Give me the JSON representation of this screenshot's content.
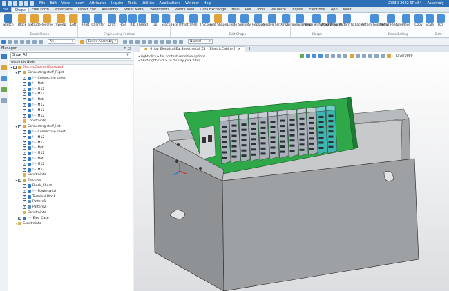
{
  "titlebar": {
    "menu": [
      "File",
      "Edit",
      "View",
      "Insert",
      "Attributes",
      "Inquire",
      "Tools",
      "Utilities",
      "Applications",
      "Window",
      "Help"
    ],
    "product": "ZW3D 2022 SP x64",
    "doc": "Assembly -"
  },
  "ribbon_tabs": [
    {
      "label": "File",
      "style": "file"
    },
    {
      "label": "Shape",
      "style": "active"
    },
    {
      "label": "Free Form"
    },
    {
      "label": "Wireframe"
    },
    {
      "label": "Direct Edit"
    },
    {
      "label": "Assembly"
    },
    {
      "label": "Sheet Metal"
    },
    {
      "label": "Weldments"
    },
    {
      "label": "Point Cloud"
    },
    {
      "label": "Data Exchange"
    },
    {
      "label": "Heal"
    },
    {
      "label": "PMI"
    },
    {
      "label": "Tools"
    },
    {
      "label": "Visualize"
    },
    {
      "label": "Inquire"
    },
    {
      "label": "Electrode"
    },
    {
      "label": "App"
    },
    {
      "label": "Mold"
    }
  ],
  "ribbon_buttons": [
    {
      "label": "Sketch",
      "icon": "sketch-icon",
      "color": "#3b7dc4"
    },
    {
      "label": "Block",
      "icon": "block-icon",
      "color": "#e0a23a"
    },
    {
      "label": "Extrude",
      "icon": "extrude-icon",
      "color": "#e0a23a"
    },
    {
      "label": "Revolve",
      "icon": "revolve-icon",
      "color": "#e0a23a"
    },
    {
      "label": "Sweep",
      "icon": "sweep-icon",
      "color": "#e0a23a"
    },
    {
      "label": "Loft",
      "icon": "loft-icon",
      "color": "#e0a23a"
    },
    {
      "label": "Fillet",
      "icon": "fillet-icon",
      "color": "#4a90d9"
    },
    {
      "label": "Chamfer",
      "icon": "chamfer-icon",
      "color": "#4a90d9"
    },
    {
      "label": "Draft",
      "icon": "draft-icon",
      "color": "#4a90d9"
    },
    {
      "label": "Hole",
      "icon": "hole-icon",
      "color": "#4a90d9"
    },
    {
      "label": "Rib",
      "icon": "rib-icon",
      "color": "#4a90d9"
    },
    {
      "label": "Thread",
      "icon": "thread-icon",
      "color": "#4a90d9"
    },
    {
      "label": "Lip",
      "icon": "lip-icon",
      "color": "#4a90d9"
    },
    {
      "label": "Stock",
      "icon": "stock-icon",
      "color": "#4a90d9"
    },
    {
      "label": "Face Offset",
      "icon": "face-offset-icon",
      "color": "#4a90d9"
    },
    {
      "label": "Shell",
      "icon": "shell-icon",
      "color": "#4a90d9"
    },
    {
      "label": "Thicken",
      "icon": "thicken-icon",
      "color": "#4a90d9"
    },
    {
      "label": "Add Shape",
      "icon": "add-shape-icon",
      "color": "#e0a23a"
    },
    {
      "label": "Divide",
      "icon": "divide-icon",
      "color": "#4a90d9"
    },
    {
      "label": "Simplify",
      "icon": "simplify-icon",
      "color": "#4a90d9"
    },
    {
      "label": "Replace",
      "icon": "replace-icon",
      "color": "#4a90d9"
    },
    {
      "label": "Resolve SelfX",
      "icon": "resolve-icon",
      "color": "#4a90d9"
    },
    {
      "label": "Inlay",
      "icon": "inlay-icon",
      "color": "#4a90d9"
    },
    {
      "label": "Cylindrical Bend",
      "icon": "cyl-bend-icon",
      "color": "#4a90d9"
    },
    {
      "label": "Morph with Point",
      "icon": "morph-point-icon",
      "color": "#4a90d9"
    },
    {
      "label": "Wrap to Faces",
      "icon": "wrap-faces-icon",
      "color": "#4a90d9"
    },
    {
      "label": "Wrap Pattern to Faces",
      "icon": "wrap-pattern-icon",
      "color": "#4a90d9"
    },
    {
      "label": "Pattern Geometry",
      "icon": "pattern-icon",
      "color": "#4a90d9"
    },
    {
      "label": "Mirror Feature",
      "icon": "mirror-icon",
      "color": "#4a90d9"
    },
    {
      "label": "Move",
      "icon": "move-icon",
      "color": "#4a90d9"
    },
    {
      "label": "Copy",
      "icon": "copy-icon",
      "color": "#4a90d9"
    },
    {
      "label": "Scale",
      "icon": "scale-icon",
      "color": "#4a90d9"
    },
    {
      "label": "LCS",
      "icon": "lcs-icon",
      "color": "#4a90d9"
    }
  ],
  "ribbon_groups": [
    {
      "label": "Basic Shape"
    },
    {
      "label": "Engineering Feature"
    },
    {
      "label": "Edit Shape"
    },
    {
      "label": "Morph"
    },
    {
      "label": "Basic Editing"
    },
    {
      "label": "Dat..."
    }
  ],
  "toolbar": {
    "filter_value": "All",
    "assembly_value": "Entire Assembly",
    "render_value": "Normal"
  },
  "manager": {
    "title": "Manager",
    "show_filter": "Show All",
    "column": "Assembly Node"
  },
  "tree": [
    {
      "text": "ElectricCabinet(Outdated)",
      "ind": 0,
      "ex": "▾",
      "cb": true,
      "icon": "assembly-icon",
      "root": true
    },
    {
      "text": "Connecting stuff_Right",
      "ind": 1,
      "ex": "▾",
      "cb": true,
      "icon": "subassembly-icon"
    },
    {
      "text": "!+!Connecting sheet",
      "ind": 2,
      "ex": "",
      "cb": true,
      "icon": "part-icon"
    },
    {
      "text": "!+!Nut",
      "ind": 2,
      "ex": "",
      "cb": true,
      "icon": "part-icon"
    },
    {
      "text": "!+!M12",
      "ind": 2,
      "ex": "",
      "cb": true,
      "icon": "part-icon"
    },
    {
      "text": "!+!M12",
      "ind": 2,
      "ex": "",
      "cb": true,
      "icon": "part-icon"
    },
    {
      "text": "!+!Nut",
      "ind": 2,
      "ex": "",
      "cb": true,
      "icon": "part-icon"
    },
    {
      "text": "!+!M12",
      "ind": 2,
      "ex": "",
      "cb": true,
      "icon": "part-icon"
    },
    {
      "text": "!+!M12",
      "ind": 2,
      "ex": "",
      "cb": true,
      "icon": "part-icon"
    },
    {
      "text": "!+!M12",
      "ind": 2,
      "ex": "",
      "cb": true,
      "icon": "part-icon"
    },
    {
      "text": "Constraints",
      "ind": 2,
      "ex": "›",
      "cb": false,
      "icon": "folder-icon"
    },
    {
      "text": "Connecting stuff_left",
      "ind": 1,
      "ex": "▾",
      "cb": true,
      "icon": "subassembly-icon"
    },
    {
      "text": "!+!Connecting sheet",
      "ind": 2,
      "ex": "",
      "cb": true,
      "icon": "part-icon"
    },
    {
      "text": "!+!M12",
      "ind": 2,
      "ex": "",
      "cb": true,
      "icon": "part-icon"
    },
    {
      "text": "!+!M12",
      "ind": 2,
      "ex": "",
      "cb": true,
      "icon": "part-icon"
    },
    {
      "text": "!+!Nut",
      "ind": 2,
      "ex": "",
      "cb": true,
      "icon": "part-icon"
    },
    {
      "text": "!+!M12",
      "ind": 2,
      "ex": "",
      "cb": true,
      "icon": "part-icon"
    },
    {
      "text": "!+!Nut",
      "ind": 2,
      "ex": "",
      "cb": true,
      "icon": "part-icon"
    },
    {
      "text": "!+!M12",
      "ind": 2,
      "ex": "",
      "cb": true,
      "icon": "part-icon"
    },
    {
      "text": "!+!M12",
      "ind": 2,
      "ex": "",
      "cb": true,
      "icon": "part-icon"
    },
    {
      "text": "Constraints",
      "ind": 2,
      "ex": "›",
      "cb": false,
      "icon": "folder-icon"
    },
    {
      "text": "Electrics",
      "ind": 1,
      "ex": "▾",
      "cb": true,
      "icon": "subassembly-icon"
    },
    {
      "text": "Block_Sheet",
      "ind": 2,
      "ex": "",
      "cb": true,
      "icon": "part-icon"
    },
    {
      "text": "!+!Powerswitch",
      "ind": 2,
      "ex": "",
      "cb": true,
      "icon": "part-icon"
    },
    {
      "text": "Terminal Block",
      "ind": 2,
      "ex": "",
      "cb": true,
      "icon": "part-icon"
    },
    {
      "text": "Pattern1",
      "ind": 2,
      "ex": "›",
      "cb": true,
      "icon": "pattern-node-icon"
    },
    {
      "text": "Pattern2",
      "ind": 2,
      "ex": "›",
      "cb": true,
      "icon": "pattern-node-icon"
    },
    {
      "text": "Constraints",
      "ind": 2,
      "ex": "›",
      "cb": false,
      "icon": "folder-icon"
    },
    {
      "text": "!+!Elec_Case",
      "ind": 1,
      "ex": "",
      "cb": true,
      "icon": "part-icon"
    },
    {
      "text": "Constraints",
      "ind": 1,
      "ex": "›",
      "cb": false,
      "icon": "folder-icon"
    }
  ],
  "doc_tab": {
    "label": "6_log_Electrical Eq_Sheetmetal_Z3 - [ElectricCabinet]",
    "close": "×",
    "add": "+"
  },
  "viewport": {
    "hint1": "<right-click> for context-sensitive options.",
    "hint2": "<Shift-right-click> to display pick filter.",
    "layer": "Layer0000"
  },
  "colors": {
    "titlebar": "#2d6fb5",
    "board_green": "#2fa84a",
    "case_grey": "#9ea1a4",
    "terminal_grey": "#a9b0b8",
    "terminal_teal": "#3fb5b0",
    "root_text": "#c62828"
  }
}
